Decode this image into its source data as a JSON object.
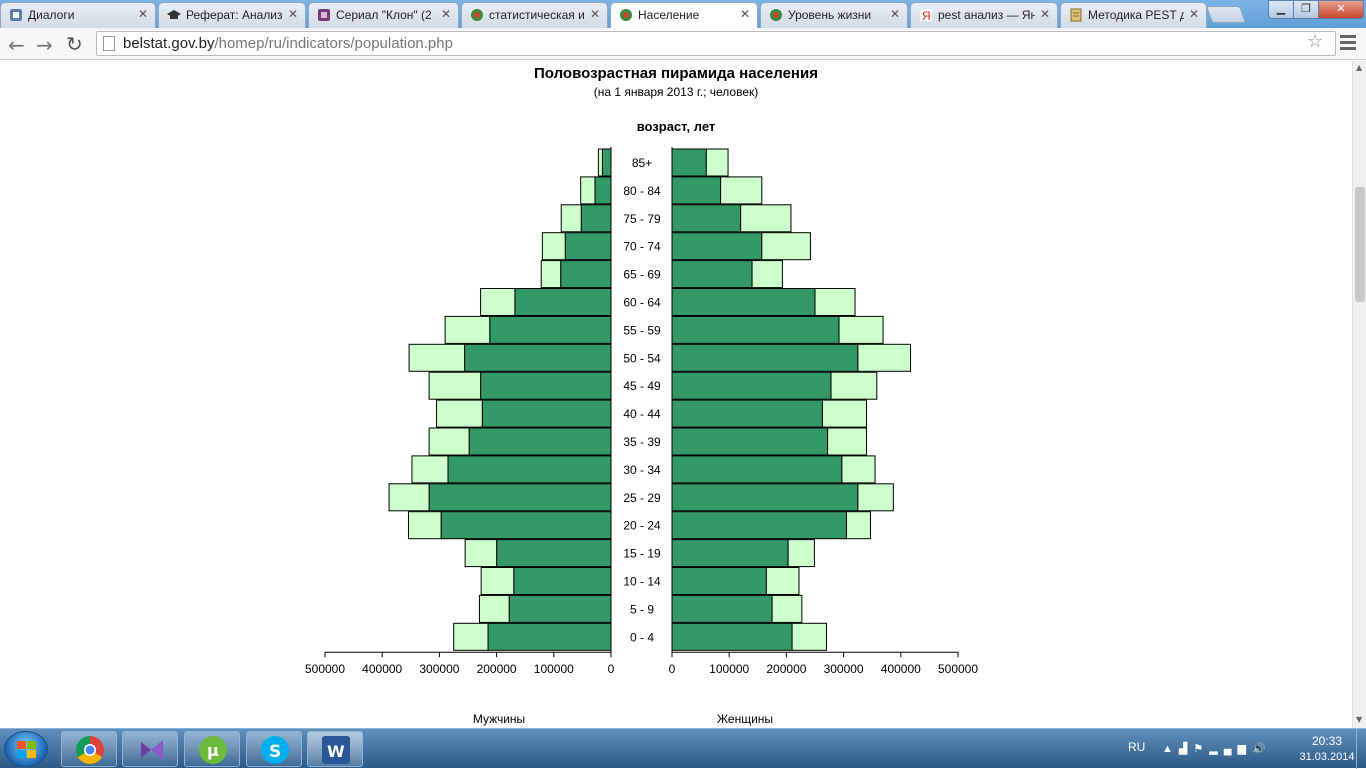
{
  "browser": {
    "tabs": [
      {
        "label": "Диалоги",
        "icon": "vk-icon",
        "active": false
      },
      {
        "label": "Реферат: Анализ",
        "icon": "graduation-cap-icon",
        "active": false
      },
      {
        "label": "Сериал \"Клон\" (2",
        "icon": "tv-icon",
        "active": false
      },
      {
        "label": "статистическая и",
        "icon": "belstat-icon",
        "active": false
      },
      {
        "label": "Население",
        "icon": "belstat-icon",
        "active": true
      },
      {
        "label": "Уровень жизни",
        "icon": "belstat-icon",
        "active": false
      },
      {
        "label": "pest анализ — Ян",
        "icon": "yandex-icon",
        "active": false
      },
      {
        "label": "Методика PEST д",
        "icon": "document-icon",
        "active": false
      }
    ],
    "url_host": "belstat.gov.by",
    "url_path": "/homep/ru/indicators/population.php"
  },
  "chart_data": {
    "type": "bar",
    "title": "Половозрастная пирамида населения",
    "subtitle": "(на 1 января 2013 г.; человек)",
    "age_axis_label": "возраст, лет",
    "categories": [
      "85+",
      "80 - 84",
      "75 - 79",
      "70 - 74",
      "65 - 69",
      "60 - 64",
      "55 - 59",
      "50 - 54",
      "45 - 49",
      "40 - 44",
      "35 - 39",
      "30 - 34",
      "25 - 29",
      "20 - 24",
      "15 - 19",
      "10 - 14",
      "5 -  9",
      "0 -  4"
    ],
    "series": [
      {
        "name": "Мужчины",
        "side": "left",
        "dark_values": [
          15000,
          28000,
          52000,
          80000,
          88000,
          168000,
          212000,
          256000,
          228000,
          225000,
          248000,
          285000,
          318000,
          297000,
          200000,
          170000,
          178000,
          215000
        ],
        "light_values": [
          7000,
          25000,
          35000,
          40000,
          34000,
          60000,
          78000,
          97000,
          90000,
          80000,
          70000,
          63000,
          70000,
          57000,
          55000,
          57000,
          52000,
          60000
        ]
      },
      {
        "name": "Женщины",
        "side": "right",
        "dark_values": [
          60000,
          85000,
          120000,
          157000,
          140000,
          250000,
          292000,
          325000,
          278000,
          263000,
          272000,
          297000,
          325000,
          305000,
          203000,
          165000,
          175000,
          210000
        ],
        "light_values": [
          38000,
          72000,
          88000,
          85000,
          53000,
          70000,
          77000,
          92000,
          80000,
          77000,
          68000,
          58000,
          62000,
          42000,
          46000,
          57000,
          52000,
          60000
        ]
      }
    ],
    "colors": {
      "dark": "#339966",
      "light": "#ccffcc",
      "stroke": "#000000"
    },
    "xlim": [
      0,
      500000
    ],
    "x_ticks_left": [
      "500000",
      "400000",
      "300000",
      "200000",
      "100000",
      "0"
    ],
    "x_ticks_right": [
      "0",
      "100000",
      "200000",
      "300000",
      "400000",
      "500000"
    ]
  },
  "taskbar": {
    "apps": [
      "chrome-icon",
      "visual-studio-icon",
      "utorrent-icon",
      "skype-icon",
      "word-icon"
    ],
    "lang": "RU",
    "time": "20:33",
    "date": "31.03.2014"
  }
}
